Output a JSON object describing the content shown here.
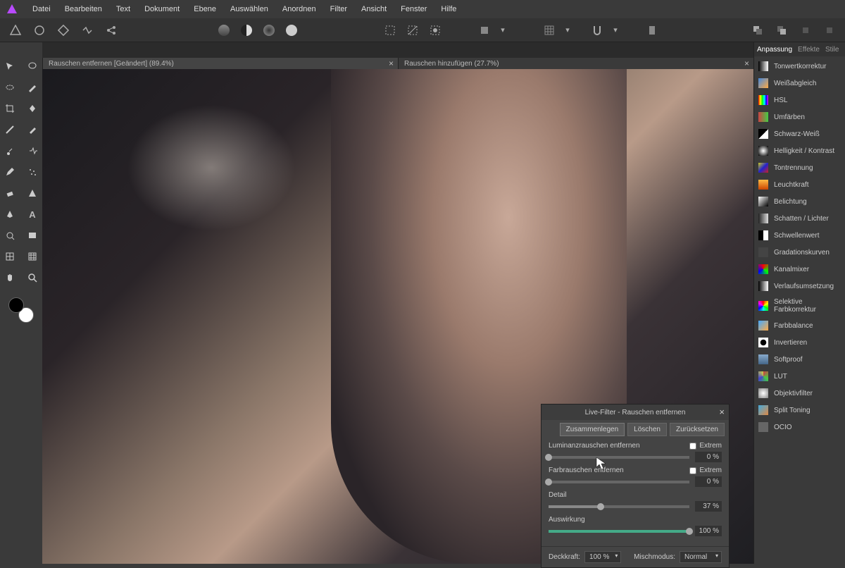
{
  "menu": [
    "Datei",
    "Bearbeiten",
    "Text",
    "Dokument",
    "Ebene",
    "Auswählen",
    "Anordnen",
    "Filter",
    "Ansicht",
    "Fenster",
    "Hilfe"
  ],
  "tabs": [
    {
      "label": "Rauschen entfernen [Geändert] (89.4%)",
      "active": true
    },
    {
      "label": "Rauschen hinzufügen (27.7%)",
      "active": false
    }
  ],
  "panel_tabs": [
    {
      "label": "Anpassung",
      "active": true
    },
    {
      "label": "Effekte",
      "active": false
    },
    {
      "label": "Stile",
      "active": false
    }
  ],
  "adjustments": [
    {
      "label": "Tonwertkorrektur",
      "bg": "linear-gradient(90deg,#000,#fff)"
    },
    {
      "label": "Weißabgleich",
      "bg": "linear-gradient(135deg,#48d,#fa4)"
    },
    {
      "label": "HSL",
      "bg": "linear-gradient(90deg,#f00,#ff0,#0f0,#0ff,#00f,#f0f)"
    },
    {
      "label": "Umfärben",
      "bg": "linear-gradient(90deg,#c44,#4c4)"
    },
    {
      "label": "Schwarz-Weiß",
      "bg": "linear-gradient(135deg,#000 50%,#fff 50%)"
    },
    {
      "label": "Helligkeit / Kontrast",
      "bg": "radial-gradient(circle,#fff,#000)"
    },
    {
      "label": "Tontrennung",
      "bg": "linear-gradient(-45deg,#c22,#22c,#cc2)"
    },
    {
      "label": "Leuchtkraft",
      "bg": "linear-gradient(#fb4,#c40)"
    },
    {
      "label": "Belichtung",
      "bg": "linear-gradient(135deg,#fff,#000)"
    },
    {
      "label": "Schatten / Lichter",
      "bg": "linear-gradient(90deg,#222,#ddd)"
    },
    {
      "label": "Schwellenwert",
      "bg": "linear-gradient(90deg,#000 50%,#fff 50%)"
    },
    {
      "label": "Gradationskurven",
      "bg": "#444"
    },
    {
      "label": "Kanalmixer",
      "bg": "conic-gradient(#f00,#0f0,#00f,#f00)"
    },
    {
      "label": "Verlaufsumsetzung",
      "bg": "linear-gradient(90deg,#000,#fff)"
    },
    {
      "label": "Selektive Farbkorrektur",
      "bg": "conic-gradient(#f00,#ff0,#0f0,#0ff,#00f,#f0f,#f00)"
    },
    {
      "label": "Farbbalance",
      "bg": "linear-gradient(135deg,#4af,#fa4)"
    },
    {
      "label": "Invertieren",
      "bg": "radial-gradient(circle,#000 40%,#fff 45%)"
    },
    {
      "label": "Softproof",
      "bg": "linear-gradient(#8ac,#468)"
    },
    {
      "label": "LUT",
      "bg": "conic-gradient(#c44,#4c4,#44c,#cc4)"
    },
    {
      "label": "Objektivfilter",
      "bg": "radial-gradient(circle,#fff,#888)"
    },
    {
      "label": "Split Toning",
      "bg": "linear-gradient(135deg,#4ad,#d84)"
    },
    {
      "label": "OCIO",
      "bg": "#666"
    }
  ],
  "dialog": {
    "title": "Live-Filter - Rauschen entfernen",
    "btn_merge": "Zusammenlegen",
    "btn_delete": "Löschen",
    "btn_reset": "Zurücksetzen",
    "luminance_label": "Luminanzrauschen entfernen",
    "extreme_label": "Extrem",
    "luminance_value": "0 %",
    "luminance_pct": 0,
    "color_label": "Farbrauschen entfernen",
    "color_value": "0 %",
    "color_pct": 0,
    "detail_label": "Detail",
    "detail_value": "37 %",
    "detail_pct": 37,
    "contribution_label": "Auswirkung",
    "contribution_value": "100 %",
    "contribution_pct": 100,
    "opacity_label": "Deckkraft:",
    "opacity_value": "100 %",
    "blend_label": "Mischmodus:",
    "blend_value": "Normal"
  }
}
